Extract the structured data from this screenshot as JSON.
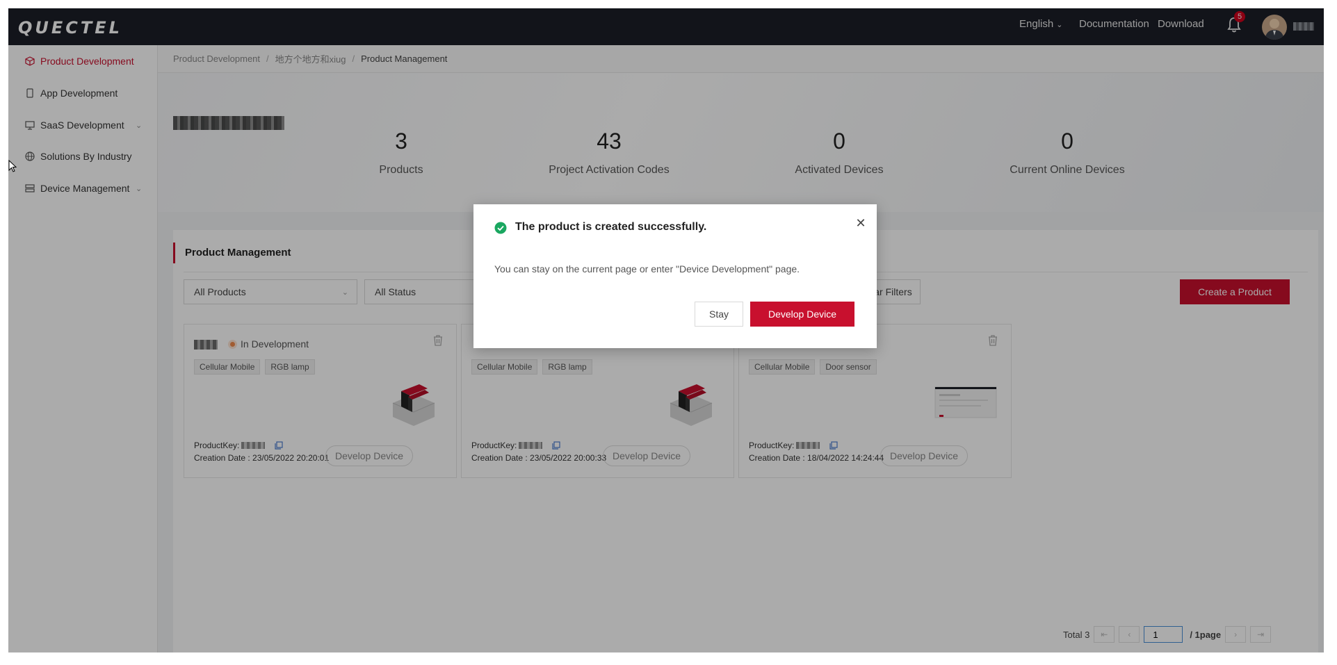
{
  "header": {
    "logo": "QUECTEL",
    "language": "English",
    "documentation": "Documentation",
    "download": "Download",
    "notification_count": "5"
  },
  "sidebar": {
    "items": [
      {
        "label": "Product Development",
        "icon": "cube-icon",
        "active": true
      },
      {
        "label": "App Development",
        "icon": "mobile-icon"
      },
      {
        "label": "SaaS Development",
        "icon": "monitor-icon",
        "expandable": true
      },
      {
        "label": "Solutions By Industry",
        "icon": "globe-icon"
      },
      {
        "label": "Device Management",
        "icon": "server-icon",
        "expandable": true
      }
    ]
  },
  "breadcrumb": [
    "Product Development",
    "地方个地方和xiug",
    "Product Management"
  ],
  "stats": [
    {
      "value": "3",
      "label": "Products"
    },
    {
      "value": "43",
      "label": "Project Activation Codes"
    },
    {
      "value": "0",
      "label": "Activated Devices"
    },
    {
      "value": "0",
      "label": "Current Online Devices"
    }
  ],
  "panel": {
    "title": "Product Management",
    "filter_products": "All Products",
    "filter_status": "All Status",
    "clear_filters": "Clear Filters",
    "create_button": "Create a Product"
  },
  "cards": [
    {
      "status": "In Development",
      "tags": [
        "Cellular Mobile",
        "RGB lamp"
      ],
      "key_label": "ProductKey:",
      "date": "Creation Date : 23/05/2022 20:20:01",
      "button": "Develop Device"
    },
    {
      "status": "",
      "tags": [
        "Cellular Mobile",
        "RGB lamp"
      ],
      "key_label": "ProductKey:",
      "date": "Creation Date : 23/05/2022 20:00:33",
      "button": "Develop Device"
    },
    {
      "status": "",
      "tags": [
        "Cellular Mobile",
        "Door sensor"
      ],
      "key_label": "ProductKey:",
      "date": "Creation Date : 18/04/2022 14:24:44",
      "button": "Develop Device"
    }
  ],
  "pagination": {
    "total": "Total 3",
    "page": "1",
    "pages": "/ 1page"
  },
  "dialog": {
    "title": "The product is created successfully.",
    "body": "You can stay on the current page or enter \"Device Development\" page.",
    "stay": "Stay",
    "develop": "Develop Device"
  },
  "colors": {
    "accent": "#c8102e",
    "topbar": "#1b1e27",
    "success": "#1aa760"
  }
}
